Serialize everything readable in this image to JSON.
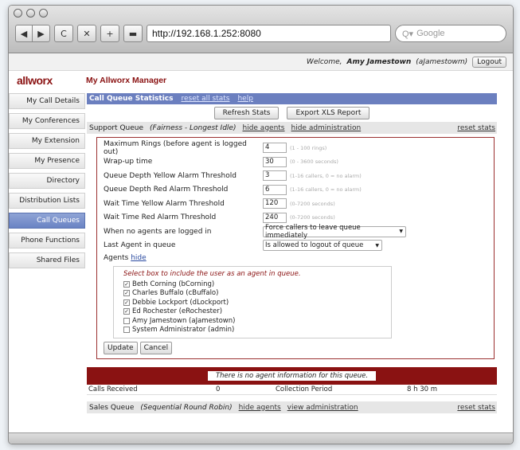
{
  "browser": {
    "url": "http://192.168.1.252:8080",
    "search_placeholder": "Google",
    "back_icon": "◀",
    "forward_icon": "▶",
    "reload_icon": "C",
    "bookmark_icon": "✕",
    "add_icon": "+",
    "print_icon": "▬",
    "search_icon": "Q▾"
  },
  "welcome": {
    "prefix": "Welcome,",
    "name": "Amy Jamestown",
    "username": "(aJamestowm)",
    "logout_label": "Logout"
  },
  "app": {
    "logo": "allworx",
    "title": "My Allworx Manager"
  },
  "sidebar": {
    "items": [
      {
        "label": "My Call Details"
      },
      {
        "label": "My Conferences"
      },
      {
        "label": "My Extension"
      },
      {
        "label": "My Presence"
      },
      {
        "label": "Directory"
      },
      {
        "label": "Distribution Lists"
      },
      {
        "label": "Call Queues"
      },
      {
        "label": "Phone Functions"
      },
      {
        "label": "Shared Files"
      }
    ]
  },
  "main": {
    "section_title": "Call Queue Statistics",
    "reset_all": "reset all stats",
    "help": "help",
    "refresh_label": "Refresh Stats",
    "export_label": "Export XLS Report",
    "support_queue": {
      "name": "Support Queue",
      "strategy": "(Fairness - Longest Idle)",
      "hide_agents": "hide agents",
      "hide_admin": "hide administration",
      "reset": "reset stats"
    },
    "settings": [
      {
        "label": "Maximum Rings (before agent is logged out)",
        "value": "4",
        "hint": "(1 - 100 rings)"
      },
      {
        "label": "Wrap-up time",
        "value": "30",
        "hint": "(0 - 3600 seconds)"
      },
      {
        "label": "Queue Depth Yellow Alarm Threshold",
        "value": "3",
        "hint": "(1-16 callers, 0 = no alarm)"
      },
      {
        "label": "Queue Depth Red Alarm Threshold",
        "value": "6",
        "hint": "(1-16 callers, 0 = no alarm)"
      },
      {
        "label": "Wait Time Yellow Alarm Threshold",
        "value": "120",
        "hint": "(0-7200 seconds)"
      },
      {
        "label": "Wait Time Red Alarm Threshold",
        "value": "240",
        "hint": "(0-7200 seconds)"
      }
    ],
    "no_agents": {
      "label": "When no agents are logged in",
      "value": "Force callers to leave queue immediately"
    },
    "last_agent": {
      "label": "Last Agent in queue",
      "value": "Is allowed to logout of queue"
    },
    "agents_label": "Agents",
    "agents_hide": "hide",
    "agents_note": "Select box to include the user as an agent in queue.",
    "agents": [
      {
        "label": "Beth Corning (bCorning)",
        "checked": "✓"
      },
      {
        "label": "Charles Buffalo (cBuffalo)",
        "checked": "✓"
      },
      {
        "label": "Debbie Lockport (dLockport)",
        "checked": "✓"
      },
      {
        "label": "Ed Rochester (eRochester)",
        "checked": "✓"
      },
      {
        "label": "Amy Jamestown (aJamestown)",
        "checked": ""
      },
      {
        "label": "System Administrator (admin)",
        "checked": ""
      }
    ],
    "update_label": "Update",
    "cancel_label": "Cancel",
    "no_info": "There is no agent information for this queue.",
    "stats": {
      "calls_received_label": "Calls Received",
      "calls_received_value": "0",
      "period_label": "Collection Period",
      "period_value": "8 h 30 m"
    },
    "sales_queue": {
      "name": "Sales Queue",
      "strategy": "(Sequential Round Robin)",
      "hide_agents": "hide agents",
      "view_admin": "view administration",
      "reset": "reset stats"
    }
  },
  "colors": {
    "brand": "#8a1212",
    "accent_blue": "#6b7fbf"
  }
}
